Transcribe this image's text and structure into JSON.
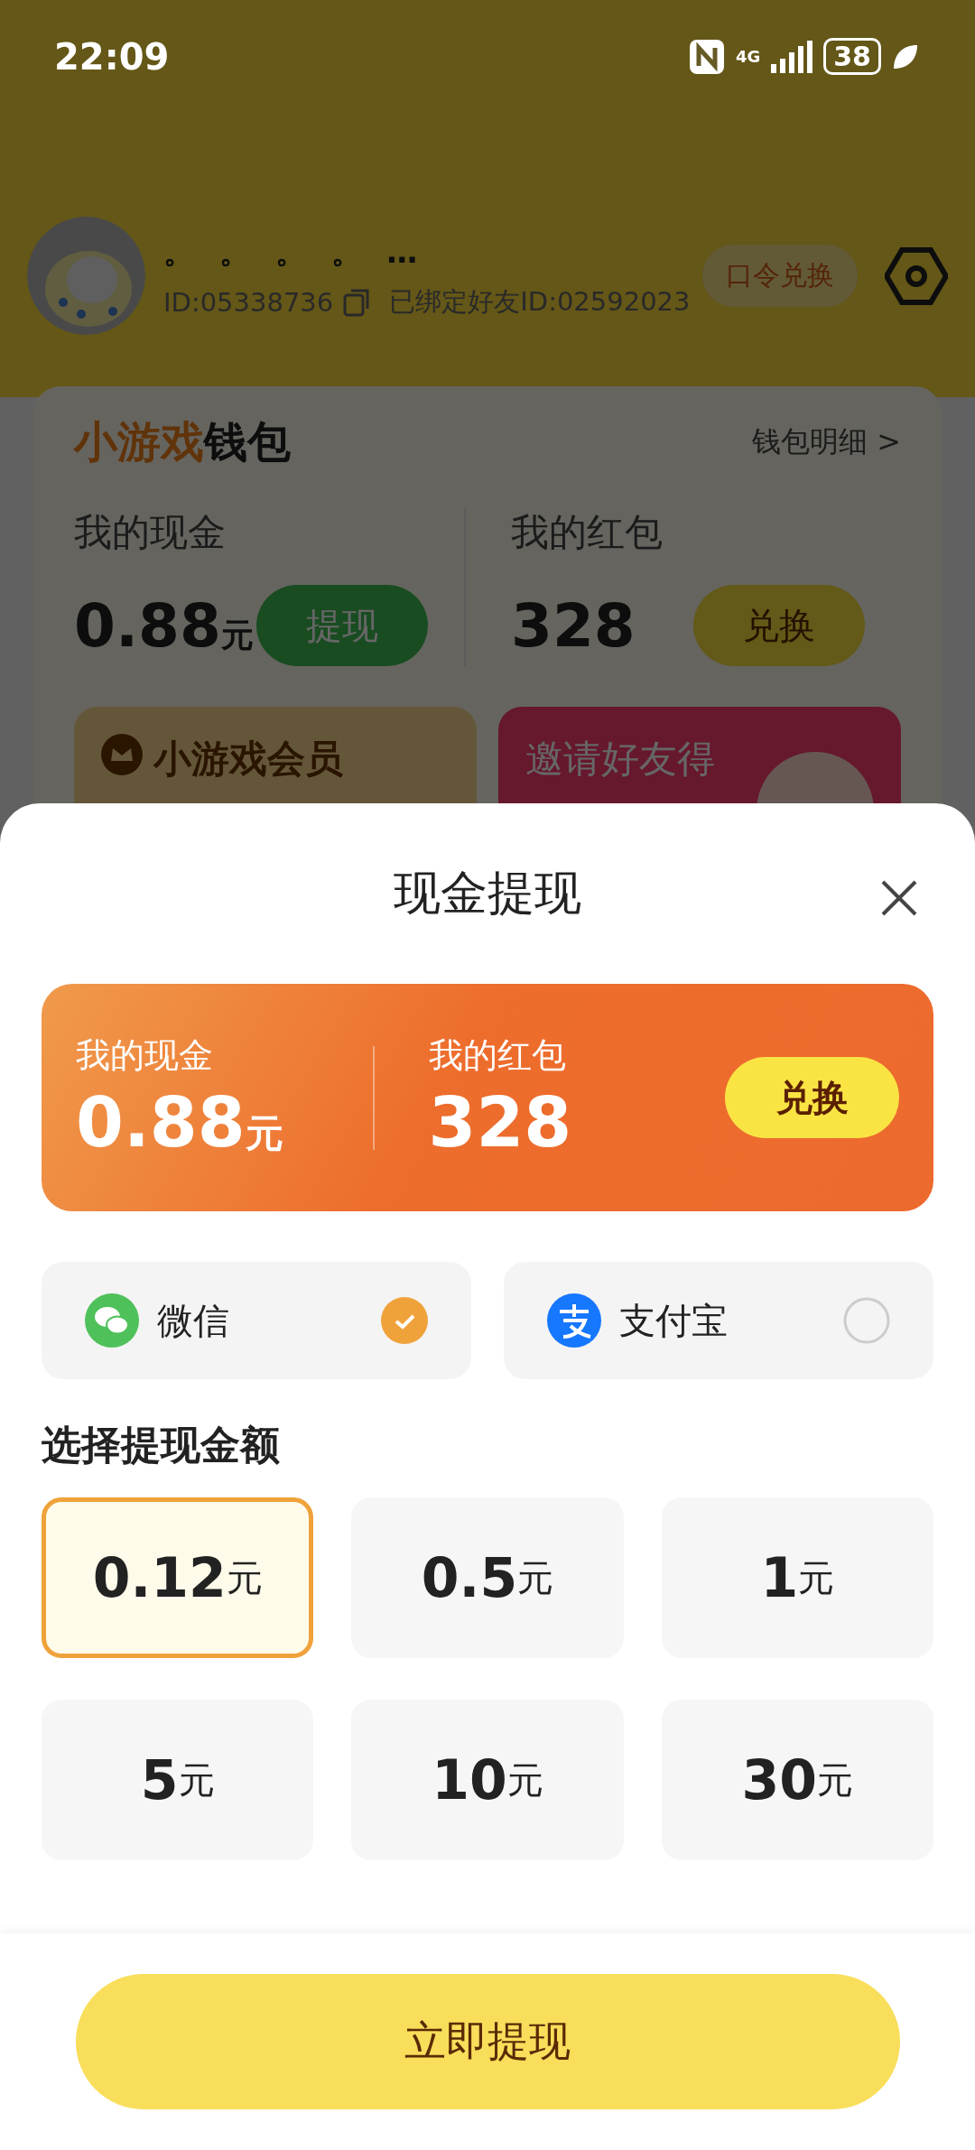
{
  "status_bar": {
    "time": "22:09",
    "network": "4G",
    "battery": "38"
  },
  "profile": {
    "nickname": "。 。 。 。 …",
    "id": "ID:05338736",
    "bound_friend": "已绑定好友ID:02592023",
    "redeem_button": "口令兑换"
  },
  "wallet": {
    "title_accent": "小游戏",
    "title_rest": "钱包",
    "detail_link": "钱包明细 >",
    "cash": {
      "label": "我的现金",
      "amount": "0.88",
      "unit": "元",
      "button": "提现"
    },
    "red_packet": {
      "label": "我的红包",
      "amount": "328",
      "button": "兑换"
    },
    "promos": [
      {
        "kind": "member",
        "title": "小游戏会员"
      },
      {
        "kind": "invite",
        "title": "邀请好友得"
      }
    ]
  },
  "sheet": {
    "title": "现金提现",
    "cash": {
      "label": "我的现金",
      "amount": "0.88",
      "unit": "元"
    },
    "red_packet": {
      "label": "我的红包",
      "amount": "328",
      "button": "兑换"
    },
    "payment_methods": [
      {
        "kind": "wechat",
        "name": "微信",
        "selected": true
      },
      {
        "kind": "alipay",
        "name": "支付宝",
        "selected": false
      }
    ],
    "amount_heading": "选择提现金额",
    "amounts": [
      {
        "value": "0.12",
        "unit": "元",
        "selected": true
      },
      {
        "value": "0.5",
        "unit": "元",
        "selected": false
      },
      {
        "value": "1",
        "unit": "元",
        "selected": false
      },
      {
        "value": "5",
        "unit": "元",
        "selected": false
      },
      {
        "value": "10",
        "unit": "元",
        "selected": false
      },
      {
        "value": "30",
        "unit": "元",
        "selected": false
      }
    ],
    "submit_button": "立即提现"
  }
}
